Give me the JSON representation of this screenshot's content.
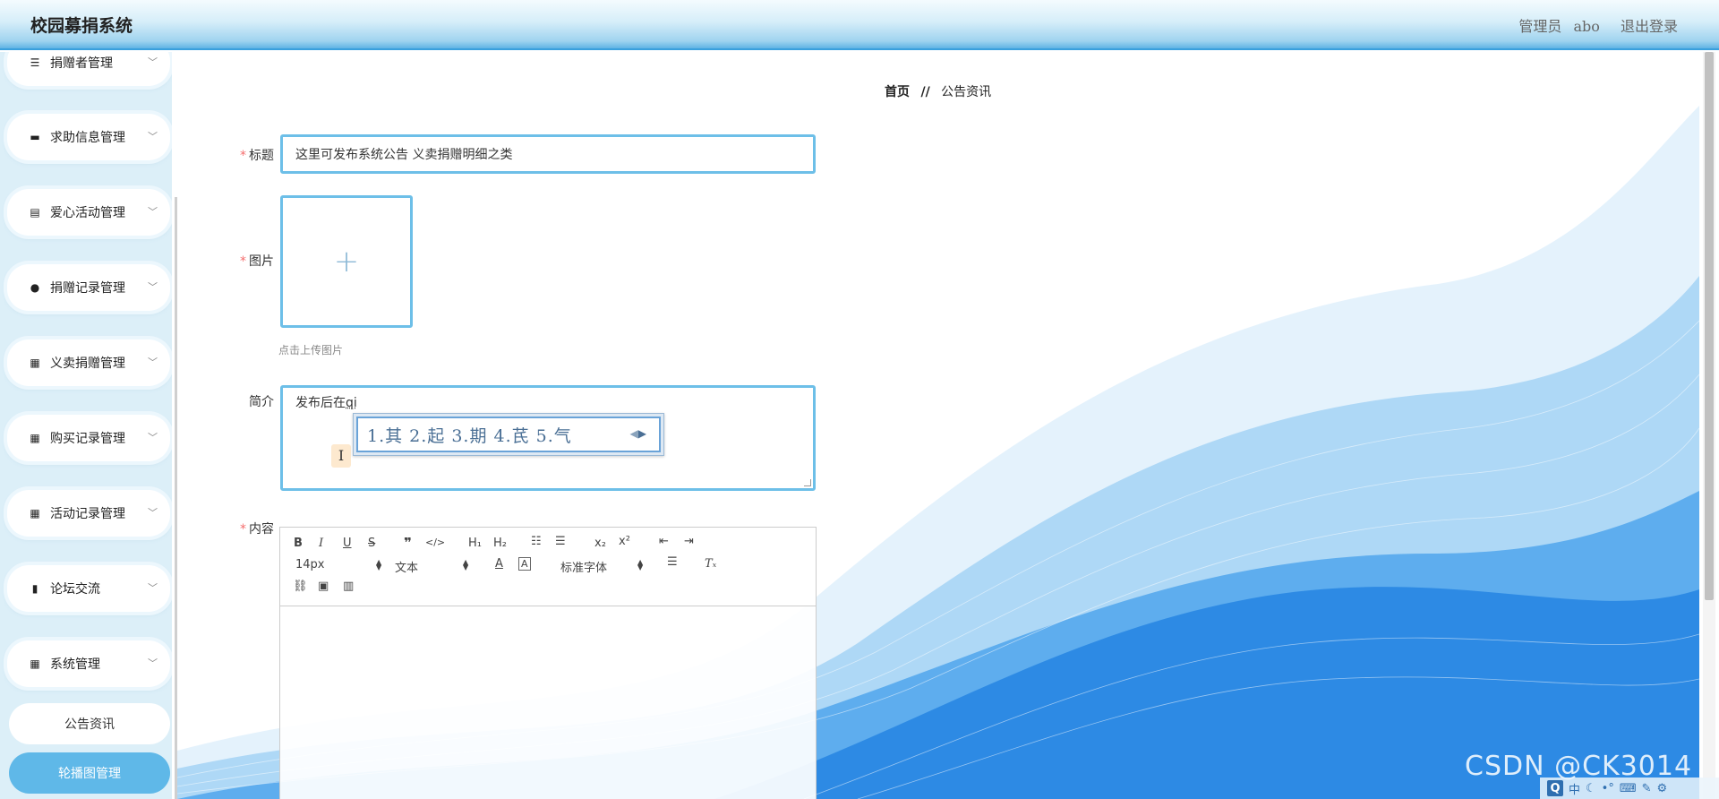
{
  "header": {
    "app_title": "校园募捐系统",
    "user_prefix": "管理员",
    "username": "abo",
    "logout_label": "退出登录"
  },
  "sidebar": {
    "items": [
      {
        "label": "捐赠者管理",
        "icon": "list-icon"
      },
      {
        "label": "求助信息管理",
        "icon": "message-icon"
      },
      {
        "label": "爱心活动管理",
        "icon": "clipboard-icon"
      },
      {
        "label": "捐赠记录管理",
        "icon": "user-icon"
      },
      {
        "label": "义卖捐赠管理",
        "icon": "grid-icon"
      },
      {
        "label": "购买记录管理",
        "icon": "grid-icon"
      },
      {
        "label": "活动记录管理",
        "icon": "grid-icon"
      },
      {
        "label": "论坛交流",
        "icon": "book-icon"
      },
      {
        "label": "系统管理",
        "icon": "grid-icon"
      }
    ],
    "sub_items": [
      {
        "label": "公告资讯",
        "state": "normal"
      },
      {
        "label": "轮播图管理",
        "state": "highlighted"
      }
    ]
  },
  "breadcrumb": {
    "home": "首页",
    "separator": "//",
    "current": "公告资讯"
  },
  "form": {
    "title_label": "标题",
    "title_value": "这里可发布系统公告 义卖捐赠明细之类",
    "image_label": "图片",
    "upload_hint": "点击上传图片",
    "intro_label": "简介",
    "intro_text": "发布后在",
    "intro_pinyin": "qi",
    "content_label": "内容",
    "required_mark": "*"
  },
  "ime": {
    "candidates": "1.其  2.起  3.期  4.芪  5.气"
  },
  "editor": {
    "font_size": "14px",
    "text_style": "文本",
    "font_family": "标准字体",
    "buttons": [
      "bold",
      "italic",
      "underline",
      "strike",
      "blockquote",
      "code",
      "h1",
      "h2",
      "ordered-list",
      "bullet-list",
      "subscript",
      "superscript",
      "outdent",
      "indent",
      "font-color",
      "background-color",
      "align",
      "clean",
      "link",
      "image",
      "video"
    ]
  },
  "watermark": "CSDN @CK3014",
  "colors": {
    "accent": "#6dbfe8",
    "active_menu": "#5fb8e8",
    "required": "#f56c6c",
    "wave_blue": "#1e88e5"
  }
}
